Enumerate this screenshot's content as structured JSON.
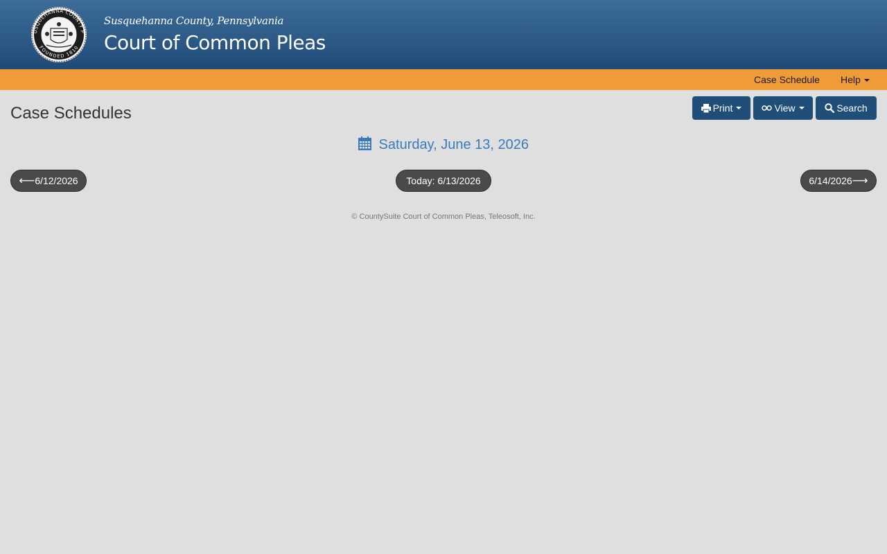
{
  "header": {
    "county": "Susquehanna County, Pennsylvania",
    "court": "Court of Common Pleas",
    "seal": {
      "top_text": "SUSQUEHANNA COUNTY PA",
      "bottom_text": "FOUNDED 1810"
    }
  },
  "nav": {
    "case_schedule": "Case Schedule",
    "help": "Help"
  },
  "page": {
    "title": "Case Schedules"
  },
  "toolbar": {
    "print": "Print",
    "view": "View",
    "search": "Search"
  },
  "schedule": {
    "date_heading": "Saturday, June 13, 2026",
    "prev_date": "6/12/2026",
    "today_label": "Today: 6/13/2026",
    "next_date": "6/14/2026"
  },
  "footer": {
    "text": "© CountySuite Court of Common Pleas, Teleosoft, Inc."
  },
  "colors": {
    "header_blue": "#2d5a87",
    "nav_orange": "#ee9b38",
    "button_blue": "#1f4e79",
    "date_blue": "#3a7bbd",
    "pill_gray": "#4a4a4a",
    "background": "#dfdfdf"
  },
  "icons": {
    "print": "printer-icon",
    "view": "glasses-icon",
    "search": "search-icon",
    "calendar": "calendar-icon",
    "left_arrow": "left-arrow-icon",
    "right_arrow": "right-arrow-icon"
  }
}
